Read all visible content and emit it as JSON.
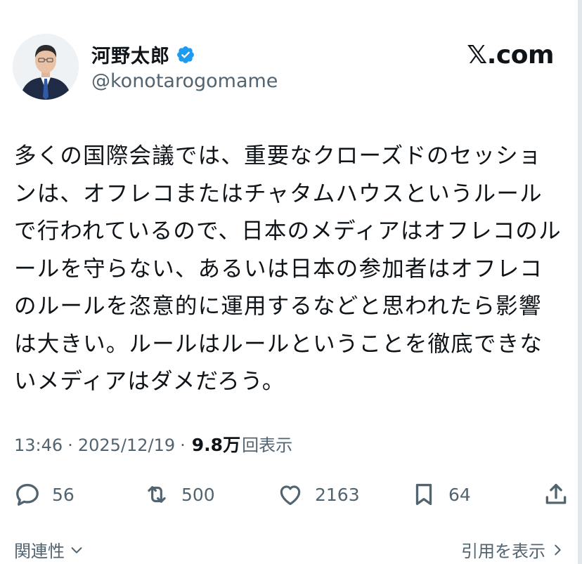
{
  "author": {
    "name": "河野太郎",
    "handle": "@konotarogomame",
    "verified": true
  },
  "brand": {
    "label": "𝕏.com"
  },
  "tweet": {
    "text": "多くの国際会議では、重要なクローズドのセッションは、オフレコまたはチャタムハウスというルールで行われているので、日本のメディアはオフレコのルールを守らない、あるいは日本の参加者はオフレコのルールを恣意的に運用するなどと思われたら影響は大きい。ルールはルールということを徹底できないメディアはダメだろう。"
  },
  "meta": {
    "time": "13:46",
    "date": "2025/12/19",
    "separator": "·",
    "views_count": "9.8万",
    "views_label": "回表示"
  },
  "actions": {
    "replies": "56",
    "reposts": "500",
    "likes": "2163",
    "bookmarks": "64"
  },
  "footer": {
    "related_label": "関連性",
    "quotes_label": "引用を表示"
  },
  "colors": {
    "text": "#0f1419",
    "secondary": "#536471",
    "verified_blue": "#1d9bf0"
  },
  "icons": [
    "reply-icon",
    "repost-icon",
    "like-icon",
    "bookmark-icon",
    "share-icon",
    "chevron-down-icon",
    "chevron-right-icon",
    "verified-badge-icon"
  ]
}
